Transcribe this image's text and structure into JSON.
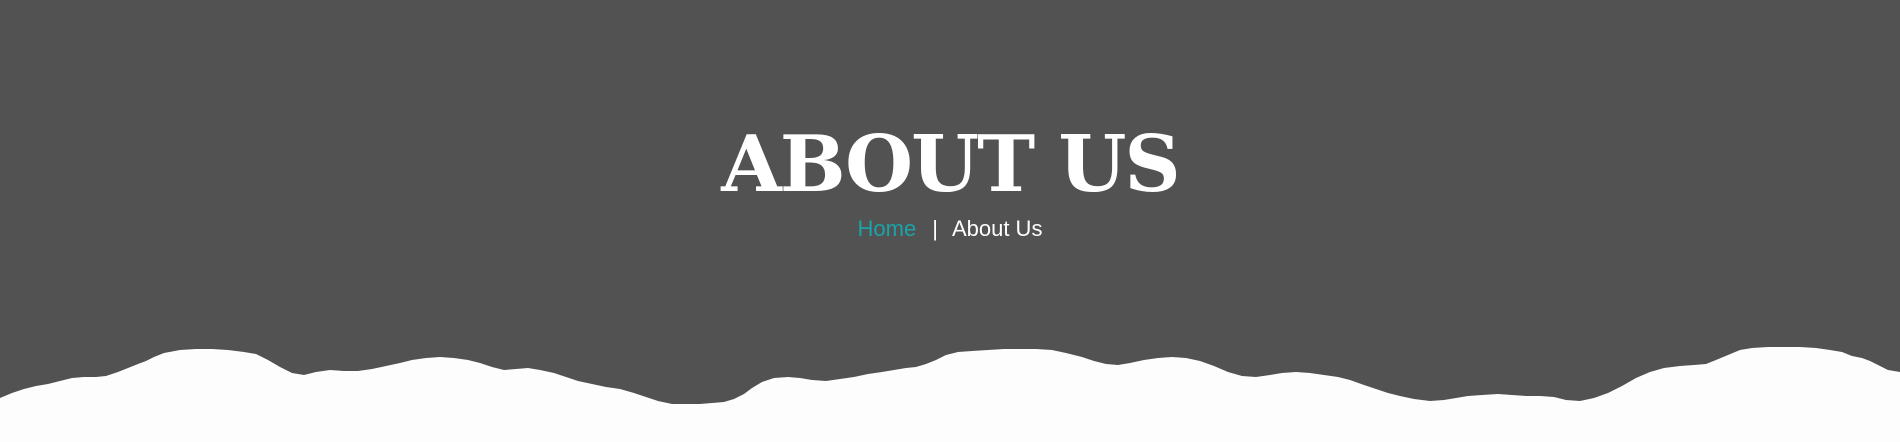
{
  "page": {
    "background_color": "#525252",
    "torn_edge_color": "#fdfdfd"
  },
  "hero": {
    "title": "ABOUT US"
  },
  "breadcrumb": {
    "home_label": "Home",
    "separator": "|",
    "current_label": "About Us",
    "link_color": "#1aa3a8",
    "text_color": "#ffffff"
  }
}
